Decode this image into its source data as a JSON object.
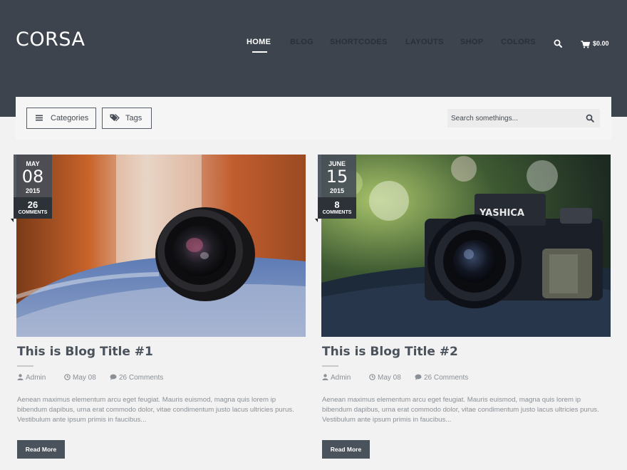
{
  "brand": {
    "logo": "CORSA"
  },
  "nav": {
    "items": [
      {
        "label": "HOME",
        "active": true
      },
      {
        "label": "BLOG",
        "active": false
      },
      {
        "label": "SHORTCODES",
        "active": false
      },
      {
        "label": "LAYOUTS",
        "active": false
      },
      {
        "label": "SHOP",
        "active": false
      },
      {
        "label": "COLORS",
        "active": false
      }
    ],
    "search_icon": "search-icon",
    "cart_icon": "cart-icon",
    "cart_total": "$0.00"
  },
  "filters": {
    "categories_label": "Categories",
    "categories_icon": "list-icon",
    "tags_label": "Tags",
    "tags_icon": "tag-icon",
    "search_placeholder": "Search somethings..."
  },
  "posts": [
    {
      "month": "MAY",
      "day": "08",
      "year": "2015",
      "comment_count": "26",
      "comments_label": "COMMENTS",
      "image": "camera-lens-photo",
      "title": "This is Blog Title #1",
      "author": "Admin",
      "date": "May 08",
      "comments": "26 Comments",
      "excerpt": "Aenean maximus elementum arcu eget feugiat. Mauris euismod, magna quis lorem ip bibendum dapibus, urna erat commodo dolor, vitae condimentum justo lacus ultricies purus. Vestibulum ante ipsum primis in faucibus...",
      "read_more": "Read More"
    },
    {
      "month": "JUNE",
      "day": "15",
      "year": "2015",
      "comment_count": "8",
      "comments_label": "COMMENTS",
      "image": "yashica-camera-photo",
      "camera_text": "YASHICA",
      "title": "This is Blog Title #2",
      "author": "Admin",
      "date": "May 08",
      "comments": "26 Comments",
      "excerpt": "Aenean maximus elementum arcu eget feugiat. Mauris euismod, magna quis lorem ip bibendum dapibus, urna erat commodo dolor, vitae condimentum justo lacus ultricies purus. Vestibulum ante ipsum primis in faucibus...",
      "read_more": "Read More"
    }
  ],
  "colors": {
    "header_bg": "#3d444d",
    "page_bg": "#f2f2f2",
    "accent_dark": "#4a525b",
    "badge_dark": "#2c3238"
  }
}
